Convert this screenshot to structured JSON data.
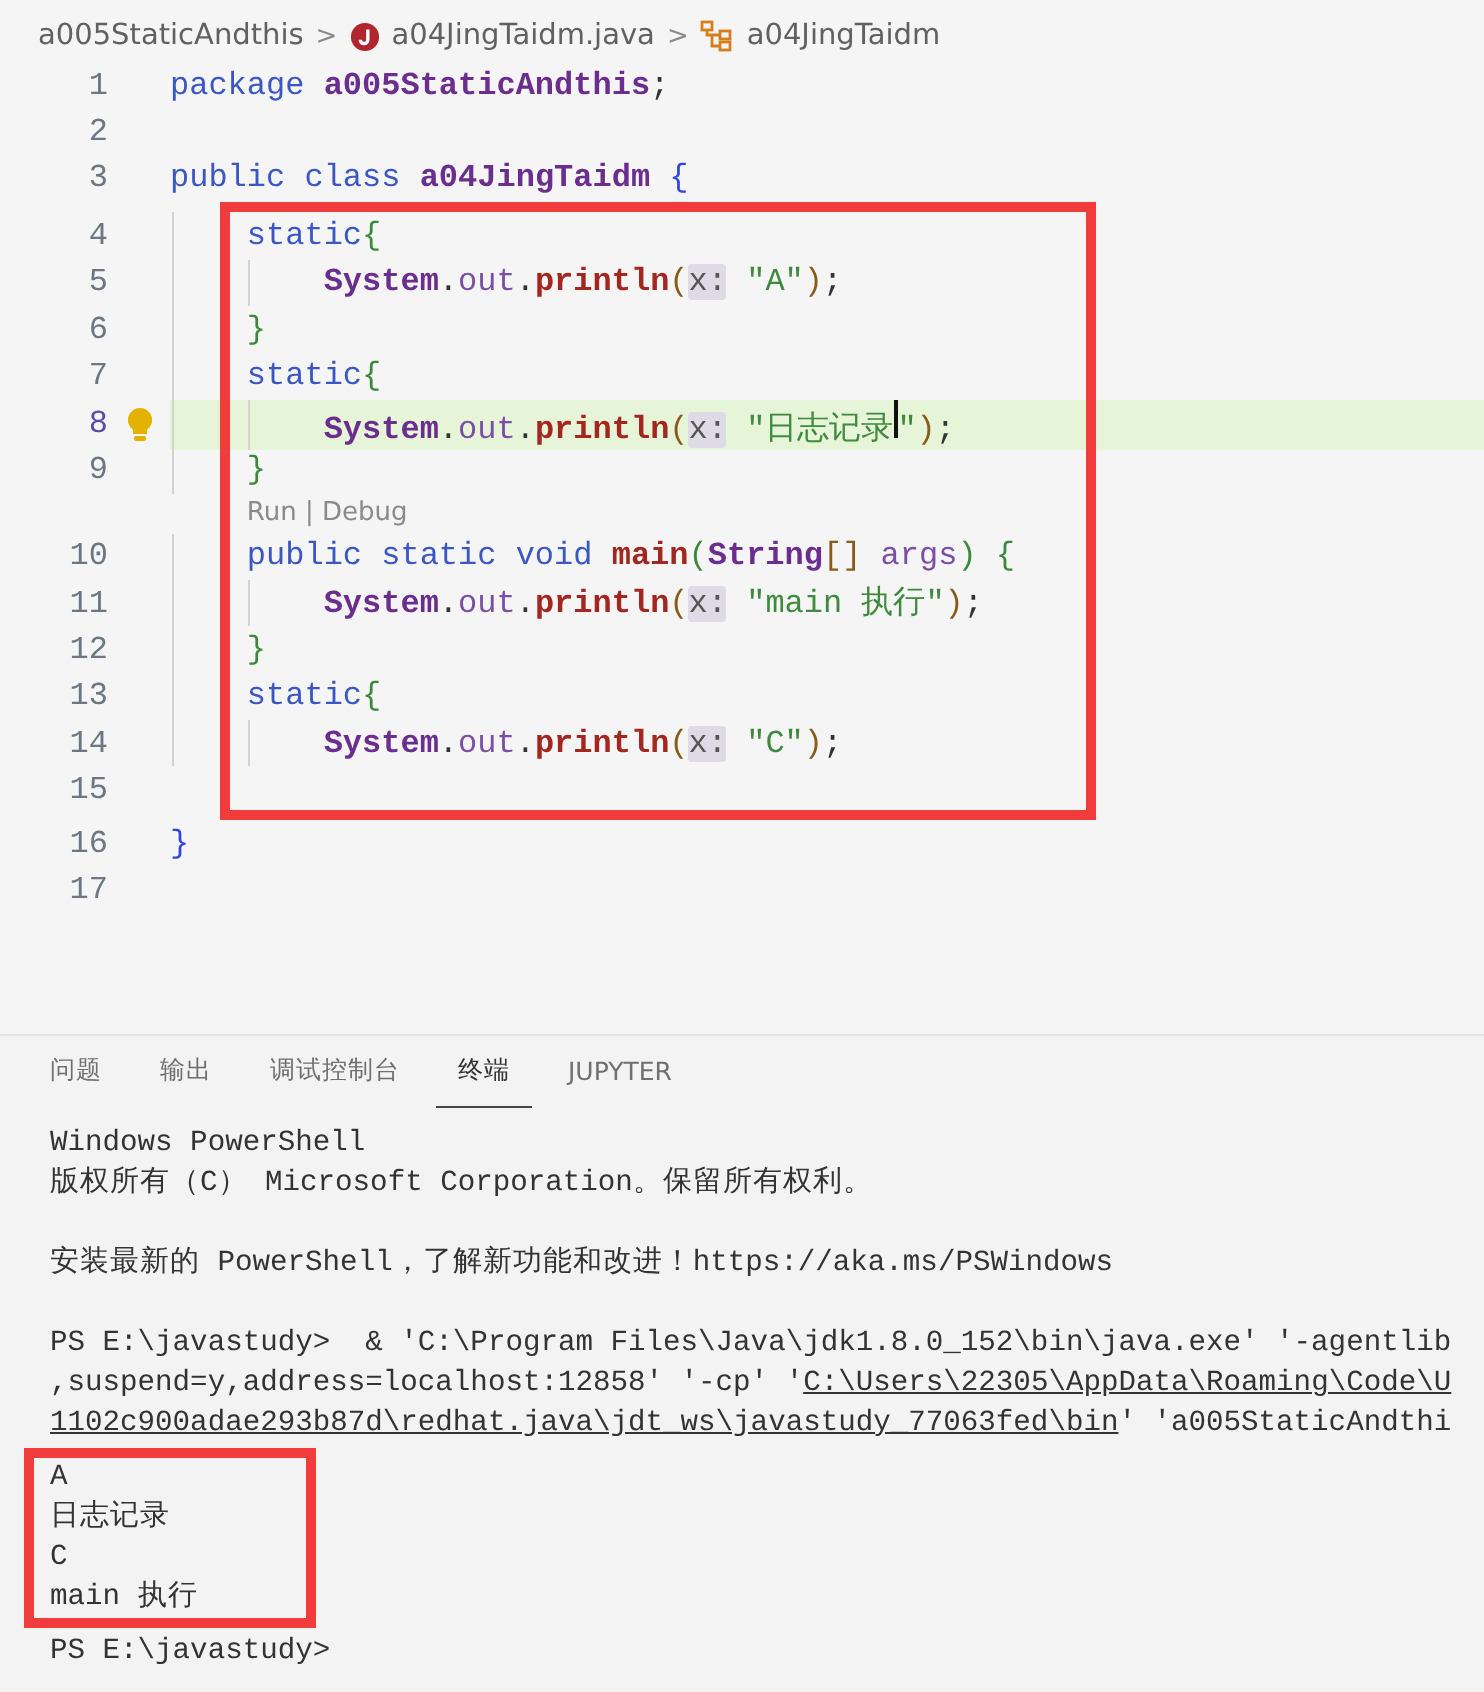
{
  "breadcrumb": [
    {
      "kind": "folder",
      "label": "a005StaticAndthis"
    },
    {
      "kind": "javafile",
      "label": "a04JingTaidm.java"
    },
    {
      "kind": "class",
      "label": "a04JingTaidm"
    }
  ],
  "breadcrumb_separator": ">",
  "editor": {
    "lines": [
      {
        "kind": "code",
        "number": "1",
        "tokens": [
          {
            "kind": "keyword",
            "text": "package "
          },
          {
            "kind": "type",
            "text": "a005StaticAndthis"
          },
          {
            "kind": "punct",
            "text": ";"
          }
        ]
      },
      {
        "kind": "code",
        "number": "2"
      },
      {
        "kind": "code",
        "number": "3",
        "tokens": [
          {
            "kind": "keyword",
            "text": "public class "
          },
          {
            "kind": "type",
            "text": "a04JingTaidm "
          },
          {
            "kind": "bracket1",
            "text": "{"
          }
        ]
      },
      {
        "kind": "frame",
        "children": [
          {
            "kind": "code",
            "number": "4",
            "tokens": [
              {
                "kind": "keyword",
                "text": "    static"
              },
              {
                "kind": "bracket2",
                "text": "{"
              }
            ]
          },
          {
            "kind": "code",
            "number": "5",
            "tokens": [
              {
                "kind": "type",
                "text": "        System"
              },
              {
                "kind": "punct",
                "text": "."
              },
              {
                "kind": "variable",
                "text": "out"
              },
              {
                "kind": "punct",
                "text": "."
              },
              {
                "kind": "method",
                "text": "println"
              },
              {
                "kind": "bracket3",
                "text": "("
              },
              {
                "kind": "hint",
                "text": "x:"
              },
              {
                "kind": "string",
                "text": " \"A\""
              },
              {
                "kind": "bracket3",
                "text": ")"
              },
              {
                "kind": "punct",
                "text": ";"
              }
            ]
          },
          {
            "kind": "code",
            "number": "6",
            "tokens": [
              {
                "kind": "bracket2",
                "text": "    }"
              }
            ]
          },
          {
            "kind": "code",
            "number": "7",
            "tokens": [
              {
                "kind": "keyword",
                "text": "    static"
              },
              {
                "kind": "bracket2",
                "text": "{"
              }
            ]
          },
          {
            "kind": "code",
            "number": "8",
            "current": true,
            "tokens": [
              {
                "kind": "type",
                "text": "        System"
              },
              {
                "kind": "punct",
                "text": "."
              },
              {
                "kind": "variable",
                "text": "out"
              },
              {
                "kind": "punct",
                "text": "."
              },
              {
                "kind": "method",
                "text": "println"
              },
              {
                "kind": "bracket3",
                "text": "("
              },
              {
                "kind": "hint",
                "text": "x:"
              },
              {
                "kind": "string",
                "text": " \"日志记录"
              },
              {
                "kind": "caret"
              },
              {
                "kind": "string",
                "text": "\""
              },
              {
                "kind": "bracket3",
                "text": ")"
              },
              {
                "kind": "punct",
                "text": ";"
              }
            ]
          },
          {
            "kind": "code",
            "number": "9",
            "tokens": [
              {
                "kind": "bracket2",
                "text": "    }"
              }
            ]
          },
          {
            "kind": "codelens",
            "actions": [
              "Run",
              "Debug"
            ],
            "separator": "|"
          },
          {
            "kind": "code",
            "number": "10",
            "tokens": [
              {
                "kind": "keyword",
                "text": "    public static void "
              },
              {
                "kind": "method",
                "text": "main"
              },
              {
                "kind": "bracket2",
                "text": "("
              },
              {
                "kind": "type",
                "text": "String"
              },
              {
                "kind": "bracket3",
                "text": "[]"
              },
              {
                "kind": "variable",
                "text": " args"
              },
              {
                "kind": "bracket2",
                "text": ")"
              },
              {
                "kind": "bracket2",
                "text": " {"
              }
            ]
          },
          {
            "kind": "code",
            "number": "11",
            "tokens": [
              {
                "kind": "type",
                "text": "        System"
              },
              {
                "kind": "punct",
                "text": "."
              },
              {
                "kind": "variable",
                "text": "out"
              },
              {
                "kind": "punct",
                "text": "."
              },
              {
                "kind": "method",
                "text": "println"
              },
              {
                "kind": "bracket3",
                "text": "("
              },
              {
                "kind": "hint",
                "text": "x:"
              },
              {
                "kind": "string",
                "text": " \"main 执行\""
              },
              {
                "kind": "bracket3",
                "text": ")"
              },
              {
                "kind": "punct",
                "text": ";"
              }
            ]
          },
          {
            "kind": "code",
            "number": "12",
            "tokens": [
              {
                "kind": "bracket2",
                "text": "    }"
              }
            ]
          },
          {
            "kind": "code",
            "number": "13",
            "tokens": [
              {
                "kind": "keyword",
                "text": "    static"
              },
              {
                "kind": "bracket2",
                "text": "{"
              }
            ]
          },
          {
            "kind": "code",
            "number": "14",
            "tokens": [
              {
                "kind": "type",
                "text": "        System"
              },
              {
                "kind": "punct",
                "text": "."
              },
              {
                "kind": "variable",
                "text": "out"
              },
              {
                "kind": "punct",
                "text": "."
              },
              {
                "kind": "method",
                "text": "println"
              },
              {
                "kind": "bracket3",
                "text": "("
              },
              {
                "kind": "hint",
                "text": "x:"
              },
              {
                "kind": "string",
                "text": " \"C\""
              },
              {
                "kind": "bracket3",
                "text": ")"
              },
              {
                "kind": "punct",
                "text": ";"
              }
            ]
          },
          {
            "kind": "code",
            "number": "15"
          }
        ]
      },
      {
        "kind": "code",
        "number": "16",
        "tokens": [
          {
            "kind": "bracket1",
            "text": "}"
          }
        ]
      },
      {
        "kind": "code",
        "number": "17"
      }
    ]
  },
  "panel": {
    "tabs": [
      {
        "label": "问题",
        "selected": false
      },
      {
        "label": "输出",
        "selected": false
      },
      {
        "label": "调试控制台",
        "selected": false
      },
      {
        "label": "终端",
        "selected": true
      },
      {
        "label": "JUPYTER",
        "selected": false
      }
    ],
    "terminal": [
      {
        "kind": "block",
        "children": [
          {
            "text": "Windows PowerShell"
          },
          {
            "text": "版权所有（C） Microsoft Corporation。保留所有权利。"
          }
        ]
      },
      {
        "kind": "block",
        "children": [
          {
            "text": "安装最新的 PowerShell，了解新功能和改进！https://aka.ms/PSWindows"
          }
        ]
      },
      {
        "kind": "block",
        "children": [
          {
            "text": "PS E:\\javastudy>  & 'C:\\Program Files\\Java\\jdk1.8.0_152\\bin\\java.exe' '-agentlib"
          },
          {
            "segments": [
              {
                "text": ",suspend=y,address=localhost:12858' '-cp' '",
                "link": false
              },
              {
                "text": "C:\\Users\\22305\\AppData\\Roaming\\Code\\U",
                "link": true
              }
            ]
          },
          {
            "segments": [
              {
                "text": "1102c900adae293b87d\\redhat.java\\jdt_ws\\javastudy_77063fed\\bin",
                "link": true
              },
              {
                "text": "' 'a005StaticAndthi",
                "link": false
              }
            ]
          }
        ]
      },
      {
        "kind": "frame",
        "children": [
          {
            "text": "A"
          },
          {
            "text": "日志记录"
          },
          {
            "text": "C"
          },
          {
            "text": "main 执行"
          }
        ]
      },
      {
        "kind": "block",
        "children": [
          {
            "text": "PS E:\\javastudy>"
          }
        ]
      }
    ]
  }
}
